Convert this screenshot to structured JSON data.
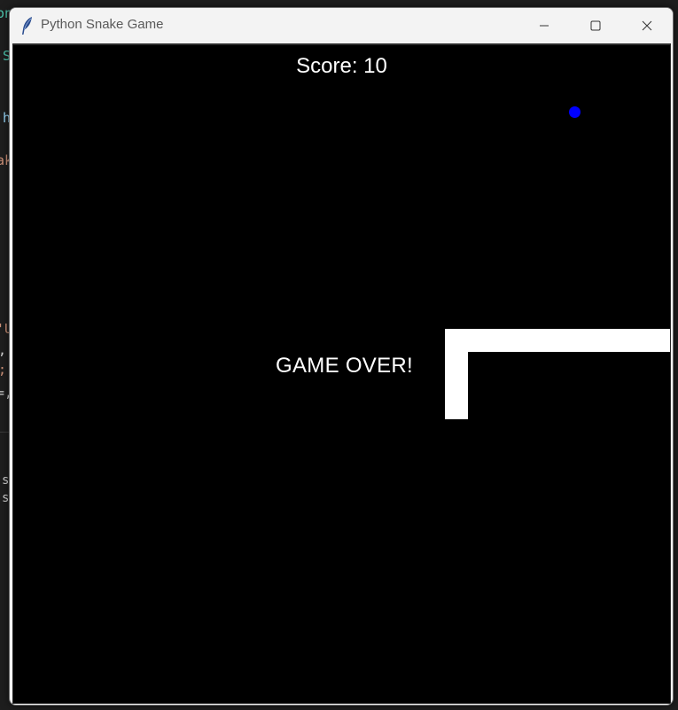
{
  "window": {
    "title": "Python Snake Game"
  },
  "icons": {
    "app": "feather-icon",
    "minimize": "minimize-icon",
    "maximize": "maximize-icon",
    "close": "close-icon"
  },
  "game": {
    "score_text": "Score: 10",
    "game_over_text": "GAME OVER!",
    "food_color": "#0000ff",
    "snake_color": "#ffffff",
    "background_color": "#000000"
  },
  "background_fragments": [
    {
      "text": "on",
      "color": "#4ec9b0"
    },
    {
      "text": "S",
      "color": "#4ec9b0"
    },
    {
      "text": "h",
      "color": "#9cdcfe"
    },
    {
      "text": "ak",
      "color": "#ce9178"
    },
    {
      "text": "'U",
      "color": "#ce9178"
    },
    {
      "text": ",",
      "color": "#d4d4d4"
    },
    {
      "text": ";",
      "color": "#ce9178"
    },
    {
      "text": "=,",
      "color": "#d4d4d4"
    },
    {
      "text": "s",
      "color": "#d4d4d4"
    },
    {
      "text": "s",
      "color": "#d4d4d4"
    }
  ]
}
